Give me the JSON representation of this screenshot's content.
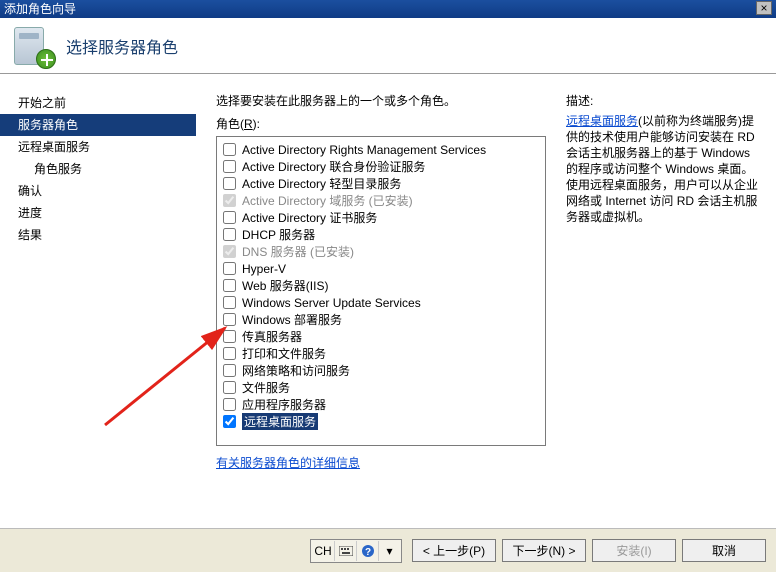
{
  "window": {
    "title": "添加角色向导"
  },
  "header": {
    "title": "选择服务器角色"
  },
  "sidebar": {
    "items": [
      {
        "label": "开始之前",
        "selected": false,
        "indent": false
      },
      {
        "label": "服务器角色",
        "selected": true,
        "indent": false
      },
      {
        "label": "远程桌面服务",
        "selected": false,
        "indent": false
      },
      {
        "label": "角色服务",
        "selected": false,
        "indent": true
      },
      {
        "label": "确认",
        "selected": false,
        "indent": false
      },
      {
        "label": "进度",
        "selected": false,
        "indent": false
      },
      {
        "label": "结果",
        "selected": false,
        "indent": false
      }
    ]
  },
  "main": {
    "instruction": "选择要安装在此服务器上的一个或多个角色。",
    "roles_label_prefix": "角色(",
    "roles_label_accesskey": "R",
    "roles_label_suffix": "):",
    "roles": [
      {
        "label": "Active Directory Rights Management Services",
        "checked": false,
        "disabled": false
      },
      {
        "label": "Active Directory 联合身份验证服务",
        "checked": false,
        "disabled": false
      },
      {
        "label": "Active Directory 轻型目录服务",
        "checked": false,
        "disabled": false
      },
      {
        "label": "Active Directory 域服务  (已安装)",
        "checked": true,
        "disabled": true
      },
      {
        "label": "Active Directory 证书服务",
        "checked": false,
        "disabled": false
      },
      {
        "label": "DHCP 服务器",
        "checked": false,
        "disabled": false
      },
      {
        "label": "DNS 服务器  (已安装)",
        "checked": true,
        "disabled": true
      },
      {
        "label": "Hyper-V",
        "checked": false,
        "disabled": false
      },
      {
        "label": "Web 服务器(IIS)",
        "checked": false,
        "disabled": false
      },
      {
        "label": "Windows Server Update Services",
        "checked": false,
        "disabled": false
      },
      {
        "label": "Windows 部署服务",
        "checked": false,
        "disabled": false
      },
      {
        "label": "传真服务器",
        "checked": false,
        "disabled": false
      },
      {
        "label": "打印和文件服务",
        "checked": false,
        "disabled": false
      },
      {
        "label": "网络策略和访问服务",
        "checked": false,
        "disabled": false
      },
      {
        "label": "文件服务",
        "checked": false,
        "disabled": false
      },
      {
        "label": "应用程序服务器",
        "checked": false,
        "disabled": false
      },
      {
        "label": "远程桌面服务",
        "checked": true,
        "disabled": false,
        "highlight": true
      }
    ],
    "more_link": "有关服务器角色的详细信息"
  },
  "description": {
    "title": "描述:",
    "link_text": "远程桌面服务",
    "body": "(以前称为终端服务)提供的技术使用户能够访问安装在 RD 会话主机服务器上的基于 Windows 的程序或访问整个 Windows 桌面。使用远程桌面服务，用户可以从企业网络或 Internet 访问 RD 会话主机服务器或虚拟机。"
  },
  "toolbar": {
    "ime": "CH",
    "kbd_icon": "keyboard-icon",
    "help_icon": "help-icon"
  },
  "buttons": {
    "prev": "< 上一步(P)",
    "next": "下一步(N) >",
    "install": "安装(I)",
    "cancel": "取消"
  }
}
